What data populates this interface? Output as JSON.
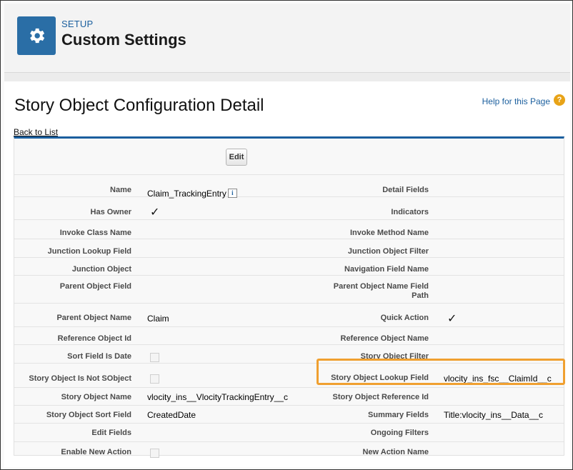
{
  "header": {
    "kicker": "SETUP",
    "title": "Custom Settings",
    "icon": "gear-icon"
  },
  "page": {
    "title": "Story Object Configuration Detail",
    "help_link": "Help for this Page",
    "help_icon_glyph": "?",
    "back_link": "Back to List",
    "edit_label": "Edit",
    "info_glyph": "i"
  },
  "fields": {
    "name": {
      "label": "Name",
      "value": "Claim_TrackingEntry"
    },
    "detail_fields": {
      "label": "Detail Fields",
      "value": ""
    },
    "has_owner": {
      "label": "Has Owner",
      "checked": true
    },
    "indicators": {
      "label": "Indicators",
      "value": ""
    },
    "invoke_class_name": {
      "label": "Invoke Class Name",
      "value": ""
    },
    "invoke_method_name": {
      "label": "Invoke Method Name",
      "value": ""
    },
    "junction_lookup_field": {
      "label": "Junction Lookup Field",
      "value": ""
    },
    "junction_object_filter": {
      "label": "Junction Object Filter",
      "value": ""
    },
    "junction_object": {
      "label": "Junction Object",
      "value": ""
    },
    "navigation_field_name": {
      "label": "Navigation Field Name",
      "value": ""
    },
    "parent_object_field": {
      "label": "Parent Object Field",
      "value": ""
    },
    "parent_object_name_field_path": {
      "label": "Parent Object Name Field Path",
      "value": ""
    },
    "parent_object_name": {
      "label": "Parent Object Name",
      "value": "Claim"
    },
    "quick_action": {
      "label": "Quick Action",
      "checked": true
    },
    "reference_object_id": {
      "label": "Reference Object Id",
      "value": ""
    },
    "reference_object_name": {
      "label": "Reference Object Name",
      "value": ""
    },
    "sort_field_is_date": {
      "label": "Sort Field Is Date",
      "checked": false
    },
    "story_object_filter": {
      "label": "Story Object Filter",
      "value": ""
    },
    "story_object_is_not_sobject": {
      "label": "Story Object Is Not SObject",
      "checked": false
    },
    "story_object_lookup_field": {
      "label": "Story Object Lookup Field",
      "value": "vlocity_ins_fsc__ClaimId__c"
    },
    "story_object_name": {
      "label": "Story Object Name",
      "value": "vlocity_ins__VlocityTrackingEntry__c"
    },
    "story_object_reference_id": {
      "label": "Story Object Reference Id",
      "value": ""
    },
    "story_object_sort_field": {
      "label": "Story Object Sort Field",
      "value": "CreatedDate"
    },
    "summary_fields": {
      "label": "Summary Fields",
      "value": "Title:vlocity_ins__Data__c"
    },
    "edit_fields": {
      "label": "Edit Fields",
      "value": ""
    },
    "ongoing_filters": {
      "label": "Ongoing Filters",
      "value": ""
    },
    "enable_new_action": {
      "label": "Enable New Action",
      "checked": false
    },
    "new_action_name": {
      "label": "New Action Name",
      "value": ""
    }
  },
  "colors": {
    "brand": "#2a6ea6",
    "link": "#1b5f9e",
    "highlight": "#f0a030",
    "help": "#e8a317"
  }
}
